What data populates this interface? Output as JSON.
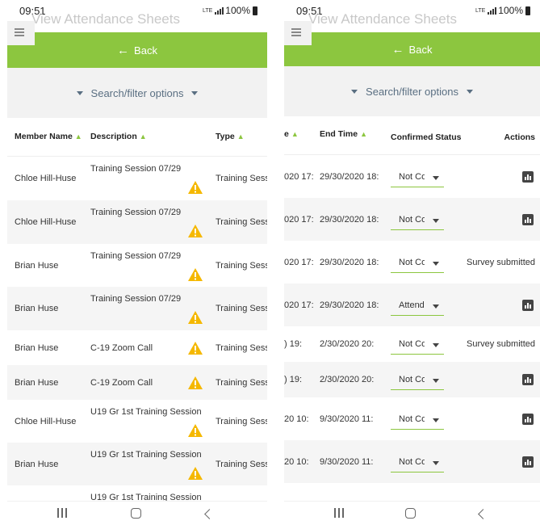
{
  "status": {
    "time": "09:51",
    "network": "LTE",
    "battery": "100%"
  },
  "ghost_title": "View Attendance Sheets",
  "back_label": "Back",
  "filter_label": "Search/filter options",
  "left": {
    "headers": {
      "member": "Member Name",
      "description": "Description",
      "type": "Type"
    },
    "rows": [
      {
        "member": "Chloe Hill-Huse",
        "description": "Training Session 07/29",
        "type": "Training Session",
        "warn": true,
        "wrap": true
      },
      {
        "member": "Chloe Hill-Huse",
        "description": "Training Session 07/29",
        "type": "Training Session",
        "warn": true,
        "wrap": true
      },
      {
        "member": "Brian Huse",
        "description": "Training Session 07/29",
        "type": "Training Session",
        "warn": true,
        "wrap": true
      },
      {
        "member": "Brian Huse",
        "description": "Training Session 07/29",
        "type": "Training Session",
        "warn": true,
        "wrap": true
      },
      {
        "member": "Brian Huse",
        "description": "C-19 Zoom Call",
        "type": "Training Session",
        "warn": true,
        "wrap": false
      },
      {
        "member": "Brian Huse",
        "description": "C-19 Zoom Call",
        "type": "Training Session",
        "warn": true,
        "wrap": false
      },
      {
        "member": "Chloe Hill-Huse",
        "description": "U19 Gr 1st Training Session",
        "type": "Training Session",
        "warn": true,
        "wrap": true
      },
      {
        "member": "Brian Huse",
        "description": "U19 Gr 1st Training Session",
        "type": "Training Session",
        "warn": true,
        "wrap": true
      },
      {
        "member": "",
        "description": "U19 Gr 1st Training Session",
        "type": "",
        "warn": false,
        "wrap": true
      }
    ]
  },
  "right": {
    "headers": {
      "start_fragment": "e",
      "end": "End Time",
      "confirmed": "Confirmed Status",
      "actions": "Actions"
    },
    "rows": [
      {
        "start": "020 17:",
        "end": "29/30/2020 18:",
        "status": "Not Confirmed",
        "action": "chart"
      },
      {
        "start": "020 17:",
        "end": "29/30/2020 18:",
        "status": "Not Confirmed",
        "action": "chart"
      },
      {
        "start": "020 17:",
        "end": "29/30/2020 18:",
        "status": "Not Confirmed",
        "action": "Survey submitted"
      },
      {
        "start": "020 17:",
        "end": "29/30/2020 18:",
        "status": "Attended",
        "action": "chart"
      },
      {
        "start": ") 19:",
        "end": "2/30/2020 20:",
        "status": "Not Confirmed",
        "action": "Survey submitted"
      },
      {
        "start": ") 19:",
        "end": "2/30/2020 20:",
        "status": "Not Confirmed",
        "action": "chart"
      },
      {
        "start": "20 10:",
        "end": "9/30/2020 11:",
        "status": "Not Confirmed",
        "action": "chart"
      },
      {
        "start": "20 10:",
        "end": "9/30/2020 11:",
        "status": "Not Confirmed",
        "action": "chart"
      }
    ]
  },
  "colors": {
    "accent": "#8cc63f",
    "warning": "#f5b800",
    "filter_text": "#5a6f82"
  },
  "icons": [
    "menu-icon",
    "back-arrow-icon",
    "caret-down-icon",
    "sort-icon",
    "warning-icon",
    "bar-chart-icon",
    "recent-apps-icon",
    "home-icon",
    "back-icon"
  ]
}
